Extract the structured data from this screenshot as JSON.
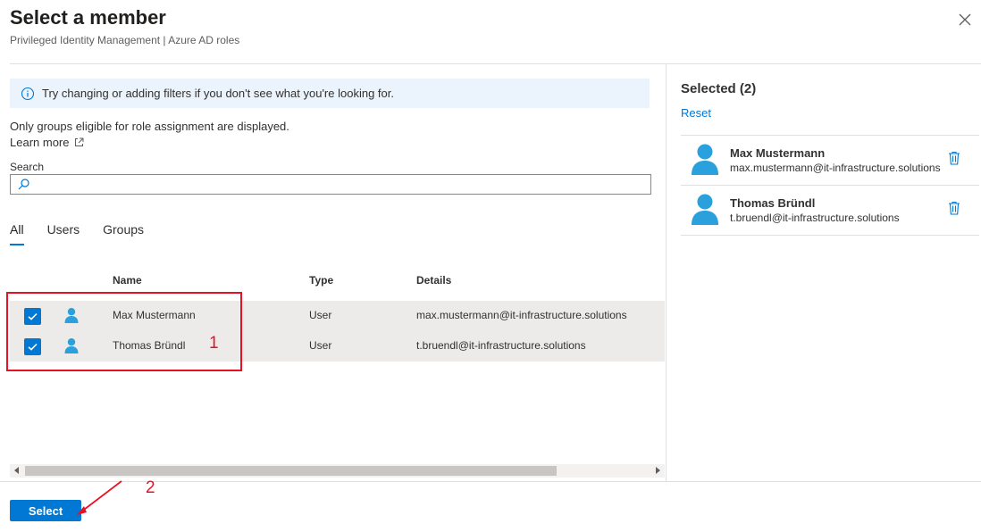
{
  "header": {
    "title": "Select a member",
    "subtitle": "Privileged Identity Management | Azure AD roles"
  },
  "info_bar": {
    "text": "Try changing or adding filters if you don't see what you're looking for."
  },
  "notes": {
    "eligible": "Only groups eligible for role assignment are displayed.",
    "learn_more": "Learn more"
  },
  "search": {
    "label": "Search",
    "value": "",
    "placeholder": ""
  },
  "tabs": [
    {
      "label": "All",
      "active": true
    },
    {
      "label": "Users",
      "active": false
    },
    {
      "label": "Groups",
      "active": false
    }
  ],
  "table": {
    "columns": [
      "Name",
      "Type",
      "Details"
    ],
    "rows": [
      {
        "checked": true,
        "name": "Max Mustermann",
        "type": "User",
        "details": "max.mustermann@it-infrastructure.solutions"
      },
      {
        "checked": true,
        "name": "Thomas Bründl",
        "type": "User",
        "details": "t.bruendl@it-infrastructure.solutions"
      }
    ]
  },
  "selected_panel": {
    "title": "Selected (2)",
    "reset_label": "Reset",
    "items": [
      {
        "name": "Max Mustermann",
        "email": "max.mustermann@it-infrastructure.solutions"
      },
      {
        "name": "Thomas Bründl",
        "email": "t.bruendl@it-infrastructure.solutions"
      }
    ]
  },
  "footer": {
    "select_label": "Select"
  },
  "annotations": {
    "marker_1": "1",
    "marker_2": "2"
  },
  "colors": {
    "accent": "#0078d4",
    "annotation": "#e81123",
    "info_bg": "#ebf3fc",
    "row_selected_bg": "#edebe9",
    "avatar": "#2aa0dc"
  },
  "icons": {
    "close": "close-icon",
    "info": "info-icon",
    "external_link": "external-link-icon",
    "search": "search-icon",
    "checkbox_checked": "checkmark-icon",
    "user": "user-icon",
    "delete": "trash-icon"
  }
}
